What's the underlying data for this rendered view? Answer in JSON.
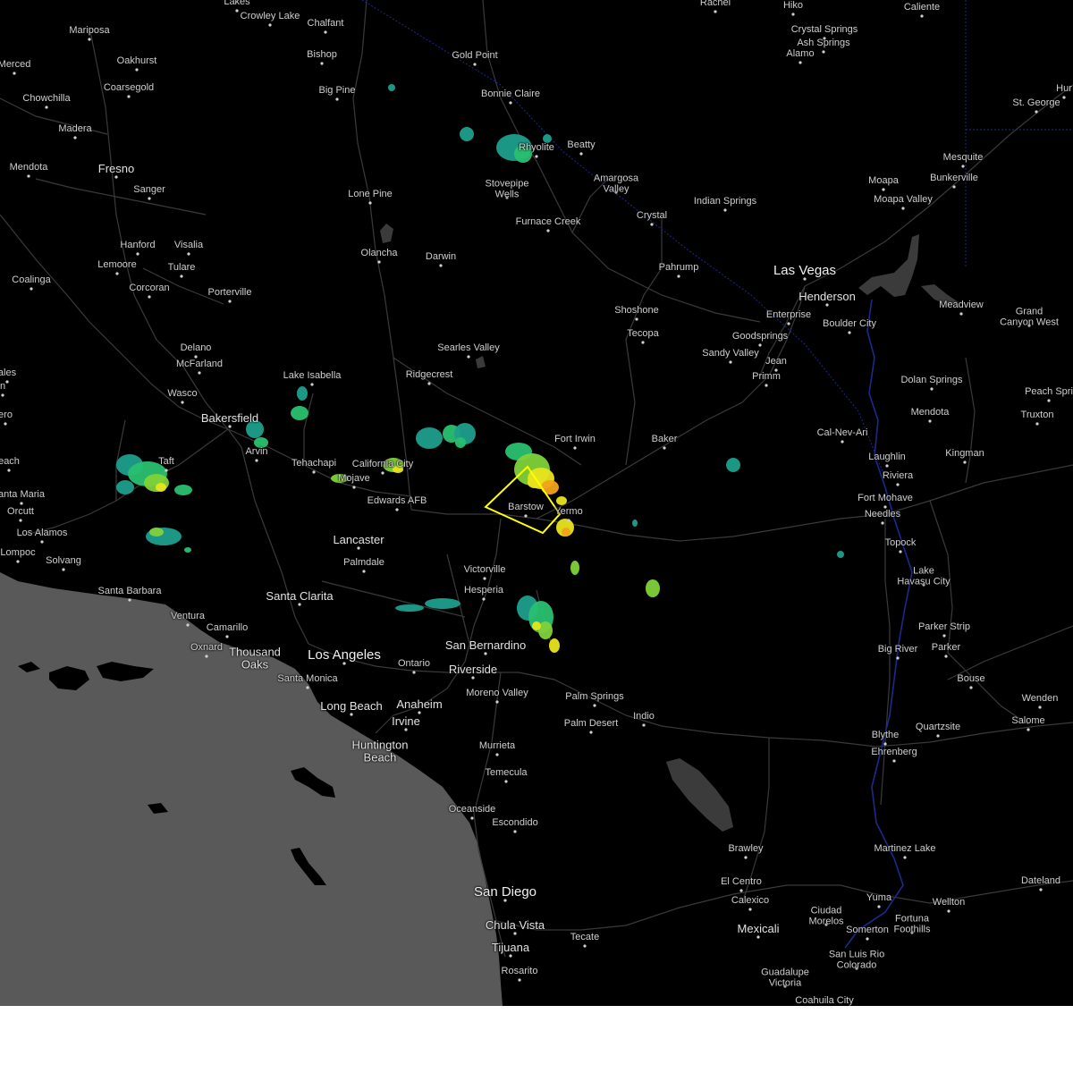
{
  "map": {
    "theme": {
      "land": "#000000",
      "ocean": "#595959",
      "road": "#3a3a3a",
      "state_border": "#1c2a8c",
      "warning_polygon": "#ffff00"
    },
    "radar_palette": [
      "#1e9e8c",
      "#29c070",
      "#7fd23a",
      "#e8e41c",
      "#f2a21a",
      "#e23e1a"
    ],
    "labels": [
      {
        "id": "lakes",
        "text": "Lakes",
        "size": "sm"
      },
      {
        "id": "crowley-lake",
        "text": "Crowley Lake",
        "size": "sm"
      },
      {
        "id": "chalfant",
        "text": "Chalfant",
        "size": "sm"
      },
      {
        "id": "rachel",
        "text": "Rachel",
        "size": "sm"
      },
      {
        "id": "hiko",
        "text": "Hiko",
        "size": "sm"
      },
      {
        "id": "caliente",
        "text": "Caliente",
        "size": "sm"
      },
      {
        "id": "crystal-springs",
        "text": "Crystal Springs",
        "size": "sm"
      },
      {
        "id": "ash-springs",
        "text": "Ash Springs",
        "size": "sm"
      },
      {
        "id": "alamo",
        "text": "Alamo",
        "size": "sm"
      },
      {
        "id": "mariposa",
        "text": "Mariposa",
        "size": "sm"
      },
      {
        "id": "oakhurst",
        "text": "Oakhurst",
        "size": "sm"
      },
      {
        "id": "bishop",
        "text": "Bishop",
        "size": "sm"
      },
      {
        "id": "gold-point",
        "text": "Gold Point",
        "size": "sm"
      },
      {
        "id": "merced",
        "text": "Merced",
        "size": "sm"
      },
      {
        "id": "coarsegold",
        "text": "Coarsegold",
        "size": "sm"
      },
      {
        "id": "big-pine",
        "text": "Big Pine",
        "size": "sm"
      },
      {
        "id": "bonnie-claire",
        "text": "Bonnie Claire",
        "size": "sm"
      },
      {
        "id": "st-george",
        "text": "St. George",
        "size": "sm"
      },
      {
        "id": "hur",
        "text": "Hur",
        "size": "sm"
      },
      {
        "id": "chowchilla",
        "text": "Chowchilla",
        "size": "sm"
      },
      {
        "id": "madera",
        "text": "Madera",
        "size": "sm"
      },
      {
        "id": "beatty",
        "text": "Beatty",
        "size": "sm"
      },
      {
        "id": "rhyolite",
        "text": "Rhyolite",
        "size": "sm"
      },
      {
        "id": "mesquite",
        "text": "Mesquite",
        "size": "sm"
      },
      {
        "id": "mendota",
        "text": "Mendota",
        "size": "sm"
      },
      {
        "id": "fresno",
        "text": "Fresno",
        "size": "md"
      },
      {
        "id": "amargosa-valley",
        "text": "Amargosa\nValley",
        "size": "sm"
      },
      {
        "id": "bunkerville",
        "text": "Bunkerville",
        "size": "sm"
      },
      {
        "id": "sanger",
        "text": "Sanger",
        "size": "sm"
      },
      {
        "id": "stovepipe-wells",
        "text": "Stovepipe\nWells",
        "size": "sm"
      },
      {
        "id": "moapa",
        "text": "Moapa",
        "size": "sm"
      },
      {
        "id": "lone-pine",
        "text": "Lone Pine",
        "size": "sm"
      },
      {
        "id": "indian-springs",
        "text": "Indian Springs",
        "size": "sm"
      },
      {
        "id": "moapa-valley",
        "text": "Moapa Valley",
        "size": "sm"
      },
      {
        "id": "crystal",
        "text": "Crystal",
        "size": "sm"
      },
      {
        "id": "furnace-creek",
        "text": "Furnace Creek",
        "size": "sm"
      },
      {
        "id": "hanford",
        "text": "Hanford",
        "size": "sm"
      },
      {
        "id": "visalia",
        "text": "Visalia",
        "size": "sm"
      },
      {
        "id": "olancha",
        "text": "Olancha",
        "size": "sm"
      },
      {
        "id": "darwin",
        "text": "Darwin",
        "size": "sm"
      },
      {
        "id": "lemoore",
        "text": "Lemoore",
        "size": "sm"
      },
      {
        "id": "tulare",
        "text": "Tulare",
        "size": "sm"
      },
      {
        "id": "pahrump",
        "text": "Pahrump",
        "size": "sm"
      },
      {
        "id": "las-vegas",
        "text": "Las Vegas",
        "size": "lg"
      },
      {
        "id": "coalinga",
        "text": "Coalinga",
        "size": "sm"
      },
      {
        "id": "henderson",
        "text": "Henderson",
        "size": "md"
      },
      {
        "id": "corcoran",
        "text": "Corcoran",
        "size": "sm"
      },
      {
        "id": "porterville",
        "text": "Porterville",
        "size": "sm"
      },
      {
        "id": "meadview",
        "text": "Meadview",
        "size": "sm"
      },
      {
        "id": "shoshone",
        "text": "Shoshone",
        "size": "sm"
      },
      {
        "id": "enterprise",
        "text": "Enterprise",
        "size": "sm"
      },
      {
        "id": "grand-canyon-west",
        "text": "Grand\nCanyon West",
        "size": "sm"
      },
      {
        "id": "boulder-city",
        "text": "Boulder City",
        "size": "sm"
      },
      {
        "id": "tecopa",
        "text": "Tecopa",
        "size": "sm"
      },
      {
        "id": "goodsprings",
        "text": "Goodsprings",
        "size": "sm"
      },
      {
        "id": "delano",
        "text": "Delano",
        "size": "sm"
      },
      {
        "id": "searles-valley",
        "text": "Searles Valley",
        "size": "sm"
      },
      {
        "id": "sandy-valley",
        "text": "Sandy Valley",
        "size": "sm"
      },
      {
        "id": "jean",
        "text": "Jean",
        "size": "sm"
      },
      {
        "id": "mcfarland",
        "text": "McFarland",
        "size": "sm"
      },
      {
        "id": "ales",
        "text": "ales",
        "size": "sm"
      },
      {
        "id": "n",
        "text": "n",
        "size": "sm"
      },
      {
        "id": "lake-isabella",
        "text": "Lake Isabella",
        "size": "sm"
      },
      {
        "id": "ridgecrest",
        "text": "Ridgecrest",
        "size": "sm"
      },
      {
        "id": "primm",
        "text": "Primm",
        "size": "sm"
      },
      {
        "id": "dolan-springs",
        "text": "Dolan Springs",
        "size": "sm"
      },
      {
        "id": "wasco",
        "text": "Wasco",
        "size": "sm"
      },
      {
        "id": "peach-springs",
        "text": "Peach Spri",
        "size": "sm"
      },
      {
        "id": "ero",
        "text": "ero",
        "size": "sm"
      },
      {
        "id": "mendota-edge",
        "text": "Mendota",
        "size": "sm"
      },
      {
        "id": "bakersfield",
        "text": "Bakersfield",
        "size": "md"
      },
      {
        "id": "truxton",
        "text": "Truxton",
        "size": "sm"
      },
      {
        "id": "cal-nev-ari",
        "text": "Cal-Nev-Ari",
        "size": "sm"
      },
      {
        "id": "fort-irwin",
        "text": "Fort Irwin",
        "size": "sm"
      },
      {
        "id": "baker",
        "text": "Baker",
        "size": "sm"
      },
      {
        "id": "arvin",
        "text": "Arvin",
        "size": "sm"
      },
      {
        "id": "kingman",
        "text": "Kingman",
        "size": "sm"
      },
      {
        "id": "laughlin",
        "text": "Laughlin",
        "size": "sm"
      },
      {
        "id": "each",
        "text": "each",
        "size": "sm"
      },
      {
        "id": "taft",
        "text": "Taft",
        "size": "sm"
      },
      {
        "id": "tehachapi",
        "text": "Tehachapi",
        "size": "sm"
      },
      {
        "id": "california-city",
        "text": "California City",
        "size": "sm"
      },
      {
        "id": "riviera",
        "text": "Riviera",
        "size": "sm"
      },
      {
        "id": "mojave",
        "text": "Mojave",
        "size": "sm"
      },
      {
        "id": "santa-maria",
        "text": "anta Maria",
        "size": "sm"
      },
      {
        "id": "fort-mohave",
        "text": "Fort Mohave",
        "size": "sm"
      },
      {
        "id": "edwards-afb",
        "text": "Edwards AFB",
        "size": "sm"
      },
      {
        "id": "barstow",
        "text": "Barstow",
        "size": "sm"
      },
      {
        "id": "yermo",
        "text": "Yermo",
        "size": "sm"
      },
      {
        "id": "orcutt",
        "text": "Orcutt",
        "size": "sm"
      },
      {
        "id": "needles",
        "text": "Needles",
        "size": "sm"
      },
      {
        "id": "los-alamos",
        "text": "Los Alamos",
        "size": "sm"
      },
      {
        "id": "lancaster",
        "text": "Lancaster",
        "size": "md"
      },
      {
        "id": "topock",
        "text": "Topock",
        "size": "sm"
      },
      {
        "id": "lompoc",
        "text": "Lompoc",
        "size": "sm"
      },
      {
        "id": "solvang",
        "text": "Solvang",
        "size": "sm"
      },
      {
        "id": "palmdale",
        "text": "Palmdale",
        "size": "sm"
      },
      {
        "id": "victorville",
        "text": "Victorville",
        "size": "sm"
      },
      {
        "id": "lake-havasu-city",
        "text": "Lake\nHavasu City",
        "size": "sm"
      },
      {
        "id": "santa-barbara",
        "text": "Santa Barbara",
        "size": "sm"
      },
      {
        "id": "hesperia",
        "text": "Hesperia",
        "size": "sm"
      },
      {
        "id": "santa-clarita",
        "text": "Santa Clarita",
        "size": "md"
      },
      {
        "id": "ventura",
        "text": "Ventura",
        "size": "sm"
      },
      {
        "id": "parker-strip",
        "text": "Parker Strip",
        "size": "sm"
      },
      {
        "id": "camarillo",
        "text": "Camarillo",
        "size": "sm"
      },
      {
        "id": "oxnard",
        "text": "Oxnard",
        "size": "sm"
      },
      {
        "id": "san-bernardino",
        "text": "San Bernardino",
        "size": "md"
      },
      {
        "id": "big-river",
        "text": "Big River",
        "size": "sm"
      },
      {
        "id": "parker",
        "text": "Parker",
        "size": "sm"
      },
      {
        "id": "thousand-oaks",
        "text": "Thousand\nOaks",
        "size": "md"
      },
      {
        "id": "los-angeles",
        "text": "Los Angeles",
        "size": "lg"
      },
      {
        "id": "ontario",
        "text": "Ontario",
        "size": "sm"
      },
      {
        "id": "riverside",
        "text": "Riverside",
        "size": "md"
      },
      {
        "id": "santa-monica",
        "text": "Santa Monica",
        "size": "sm"
      },
      {
        "id": "bouse",
        "text": "Bouse",
        "size": "sm"
      },
      {
        "id": "moreno-valley",
        "text": "Moreno Valley",
        "size": "sm"
      },
      {
        "id": "palm-springs",
        "text": "Palm Springs",
        "size": "sm"
      },
      {
        "id": "wenden",
        "text": "Wenden",
        "size": "sm"
      },
      {
        "id": "anaheim",
        "text": "Anaheim",
        "size": "md"
      },
      {
        "id": "long-beach",
        "text": "Long Beach",
        "size": "md"
      },
      {
        "id": "salome",
        "text": "Salome",
        "size": "sm"
      },
      {
        "id": "indio",
        "text": "Indio",
        "size": "sm"
      },
      {
        "id": "irvine",
        "text": "Irvine",
        "size": "md"
      },
      {
        "id": "palm-desert",
        "text": "Palm Desert",
        "size": "sm"
      },
      {
        "id": "quartzsite",
        "text": "Quartzsite",
        "size": "sm"
      },
      {
        "id": "huntington-beach",
        "text": "Huntington\nBeach",
        "size": "md"
      },
      {
        "id": "murrieta",
        "text": "Murrieta",
        "size": "sm"
      },
      {
        "id": "blythe",
        "text": "Blythe",
        "size": "sm"
      },
      {
        "id": "ehrenberg",
        "text": "Ehrenberg",
        "size": "sm"
      },
      {
        "id": "temecula",
        "text": "Temecula",
        "size": "sm"
      },
      {
        "id": "oceanside",
        "text": "Oceanside",
        "size": "sm"
      },
      {
        "id": "escondido",
        "text": "Escondido",
        "size": "sm"
      },
      {
        "id": "brawley",
        "text": "Brawley",
        "size": "sm"
      },
      {
        "id": "martinez-lake",
        "text": "Martinez Lake",
        "size": "sm"
      },
      {
        "id": "el-centro",
        "text": "El Centro",
        "size": "sm"
      },
      {
        "id": "dateland",
        "text": "Dateland",
        "size": "sm"
      },
      {
        "id": "san-diego",
        "text": "San Diego",
        "size": "lg"
      },
      {
        "id": "yuma",
        "text": "Yuma",
        "size": "sm"
      },
      {
        "id": "calexico",
        "text": "Calexico",
        "size": "sm"
      },
      {
        "id": "wellton",
        "text": "Wellton",
        "size": "sm"
      },
      {
        "id": "chula-vista",
        "text": "Chula Vista",
        "size": "md"
      },
      {
        "id": "ciudad-morelos",
        "text": "Ciudad\nMorelos",
        "size": "sm"
      },
      {
        "id": "fortuna-foothills",
        "text": "Fortuna\nFoothills",
        "size": "sm"
      },
      {
        "id": "mexicali",
        "text": "Mexicali",
        "size": "md"
      },
      {
        "id": "somerton",
        "text": "Somerton",
        "size": "sm"
      },
      {
        "id": "tijuana",
        "text": "Tijuana",
        "size": "md"
      },
      {
        "id": "tecate",
        "text": "Tecate",
        "size": "sm"
      },
      {
        "id": "san-luis-rio-colorado",
        "text": "San Luis Rio\nColorado",
        "size": "sm"
      },
      {
        "id": "rosarito",
        "text": "Rosarito",
        "size": "sm"
      },
      {
        "id": "guadalupe-victoria",
        "text": "Guadalupe\nVictoria",
        "size": "sm"
      },
      {
        "id": "coahuila-city",
        "text": "Coahuila City",
        "size": "sm"
      }
    ]
  }
}
